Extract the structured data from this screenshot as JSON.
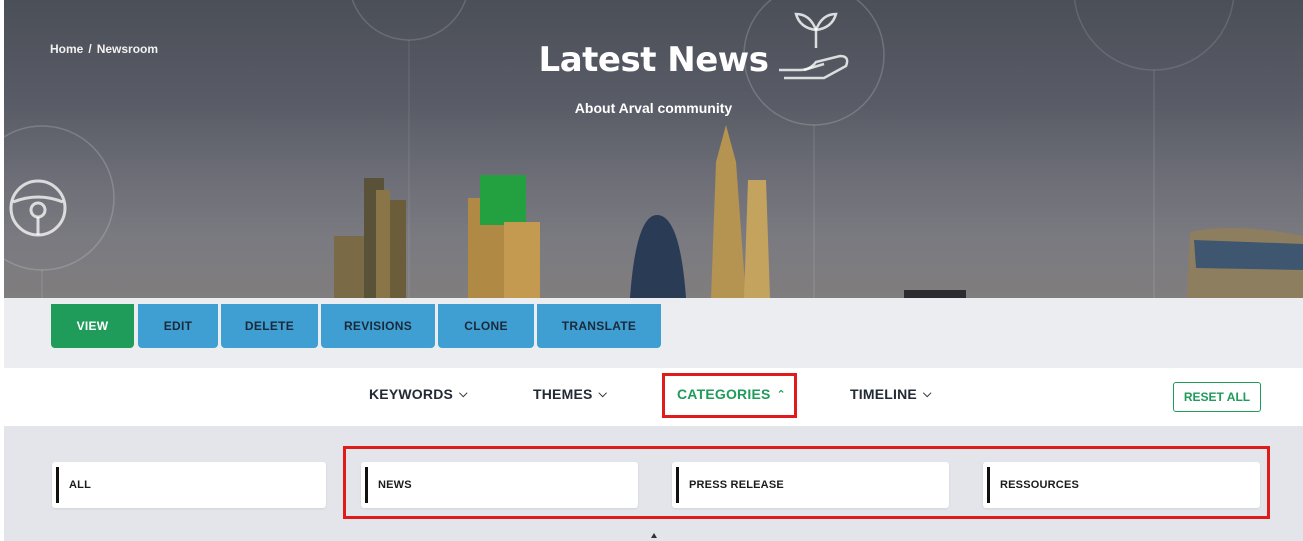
{
  "breadcrumb": {
    "home": "Home",
    "separator": "/",
    "current": "Newsroom"
  },
  "hero": {
    "title": "Latest News",
    "subtitle": "About Arval community"
  },
  "admin_tabs": [
    {
      "label": "VIEW",
      "active": true
    },
    {
      "label": "EDIT",
      "active": false
    },
    {
      "label": "DELETE",
      "active": false
    },
    {
      "label": "REVISIONS",
      "active": false
    },
    {
      "label": "CLONE",
      "active": false
    },
    {
      "label": "TRANSLATE",
      "active": false
    }
  ],
  "filters": [
    {
      "label": "KEYWORDS",
      "chevron": "chevron-down-icon"
    },
    {
      "label": "THEMES",
      "chevron": "chevron-down-icon"
    },
    {
      "label": "CATEGORIES",
      "chevron": "chevron-up-icon",
      "active": true
    },
    {
      "label": "TIMELINE",
      "chevron": "chevron-down-icon"
    }
  ],
  "reset_label": "RESET ALL",
  "categories": [
    "ALL",
    "NEWS",
    "PRESS RELEASE",
    "RESSOURCES"
  ],
  "colors": {
    "accent_green": "#1f9b5a",
    "tab_blue": "#3f9fd3",
    "highlight_red": "#e01b1b",
    "panel_grey": "#e3e5ea"
  }
}
